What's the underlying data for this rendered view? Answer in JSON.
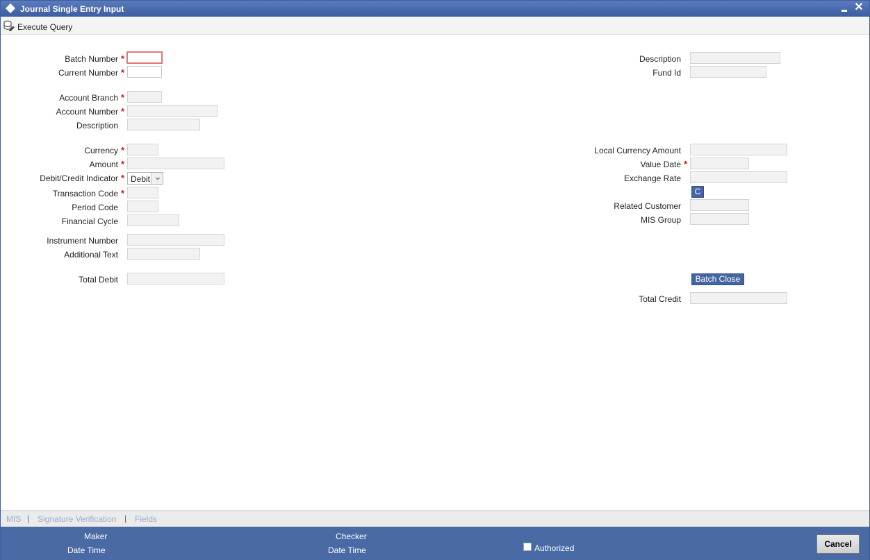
{
  "window": {
    "title": "Journal Single Entry Input"
  },
  "toolbar": {
    "execute_query": "Execute Query"
  },
  "left": {
    "batch_number": "Batch Number",
    "current_number": "Current Number",
    "account_branch": "Account Branch",
    "account_number": "Account Number",
    "description": "Description",
    "currency": "Currency",
    "amount": "Amount",
    "debit_credit_indicator": "Debit/Credit Indicator",
    "debit_credit_value": "Debit",
    "transaction_code": "Transaction Code",
    "period_code": "Period Code",
    "financial_cycle": "Financial Cycle",
    "instrument_number": "Instrument Number",
    "additional_text": "Additional Text",
    "total_debit": "Total Debit"
  },
  "right": {
    "description": "Description",
    "fund_id": "Fund Id",
    "local_currency_amount": "Local Currency Amount",
    "value_date": "Value Date",
    "exchange_rate": "Exchange Rate",
    "c_button": "C",
    "related_customer": "Related Customer",
    "mis_group": "MIS Group",
    "batch_close": "Batch Close",
    "total_credit": "Total Credit"
  },
  "required_marker": "*",
  "tabs": {
    "mis": "MIS",
    "signature_verification": "Signature Verification",
    "fields": "Fields",
    "separator": "|"
  },
  "footer": {
    "maker": "Maker",
    "maker_date_time": "Date Time",
    "checker": "Checker",
    "checker_date_time": "Date Time",
    "authorized": "Authorized",
    "cancel": "Cancel"
  },
  "colors": {
    "titlebar": "#3c5d9f",
    "footer": "#4a6aa5",
    "required": "#dd1111",
    "button": "#4465a3"
  }
}
